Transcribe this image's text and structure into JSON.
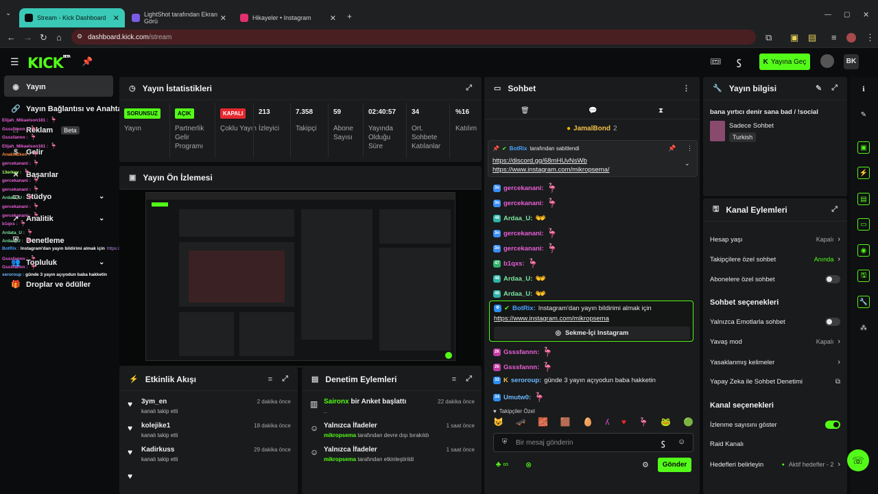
{
  "browser": {
    "tabs": [
      {
        "label": "Stream - Kick Dashboard",
        "fav": "#53fc18"
      },
      {
        "label": "LightShot tarafından Ekran Görü",
        "fav": "#7b5ce6"
      },
      {
        "label": "Hikayeler • Instagram",
        "fav": "#e1306c"
      }
    ],
    "url_host": "dashboard.kick.com",
    "url_path": "/stream"
  },
  "header": {
    "logo": "KICK",
    "logo_sup": "BETA",
    "go_live": "Yayına Geç"
  },
  "sidenav": {
    "items": [
      {
        "label": "Yayın",
        "icon": "◉"
      },
      {
        "label": "Yayın Bağlantısı ve Anahtar",
        "icon": "🔗"
      },
      {
        "label": "Reklam",
        "icon": "□",
        "badge": "Beta"
      },
      {
        "label": "Gelir",
        "icon": "$"
      },
      {
        "label": "Başarılar",
        "icon": "✕"
      },
      {
        "label": "Stüdyo",
        "icon": "▭"
      },
      {
        "label": "Analitik",
        "icon": "↗"
      },
      {
        "label": "Denetleme",
        "icon": "⛨"
      },
      {
        "label": "Topluluk",
        "icon": "👥"
      },
      {
        "label": "Droplar ve ödüller",
        "icon": "🎁"
      }
    ]
  },
  "overlay_chat": [
    {
      "user": "Elijah_Mikaelson181 :",
      "color": "#e85fd6"
    },
    {
      "user": "Gsssfannn :",
      "color": "#e85fd6"
    },
    {
      "user": "Gsssfannn :",
      "color": "#e85fd6"
    },
    {
      "user": "Elijah_Mikaelson181 :",
      "color": "#e85fd6"
    },
    {
      "user": "Anakin2ken :",
      "color": "#ff8a3d"
    },
    {
      "user": "gercekanani :",
      "color": "#e85fd6"
    },
    {
      "user": "13erkay :",
      "color": "#a5ff6b"
    },
    {
      "user": "gercekanani :",
      "color": "#e85fd6"
    },
    {
      "user": "gercekanani :",
      "color": "#e85fd6"
    },
    {
      "user": "Ardata_U :",
      "color": "#7de4a2"
    },
    {
      "user": "gercekanani :",
      "color": "#e85fd6"
    },
    {
      "user": "gercekanani :",
      "color": "#e85fd6"
    },
    {
      "user": "b1qxs :",
      "color": "#e85fd6"
    },
    {
      "user": "Ardata_U :",
      "color": "#7de4a2"
    },
    {
      "user": "Ardaa_U :",
      "color": "#7de4a2"
    },
    {
      "user": "BotRix :",
      "color": "#4aa3ff",
      "text": "Instagram'dan yayın bildirimi almak için",
      "link": "https://www.instagram.com/mikropsema"
    },
    {
      "user": "Gsssfannn :",
      "color": "#e85fd6"
    },
    {
      "user": "Gsssfannn :",
      "color": "#e85fd6"
    },
    {
      "user": "seroroup :",
      "color": "#6fb7ff",
      "text": "günde 3 yayın açıyodun baba hakketin"
    }
  ],
  "stats": {
    "title": "Yayın İstatistikleri",
    "items": [
      {
        "badge": "SORUNSUZ",
        "badge_color": "#53fc18",
        "label": "Yayın"
      },
      {
        "badge": "AÇIK",
        "badge_color": "#53fc18",
        "label": "Partnerlik Gelir Programı"
      },
      {
        "badge": "KAPALI",
        "badge_color": "#e5282e",
        "label": "Çoklu Yayın"
      },
      {
        "value": "213",
        "label": "İzleyici"
      },
      {
        "value": "7.358",
        "label": "Takipçi"
      },
      {
        "value": "59",
        "label": "Abone Sayısı"
      },
      {
        "value": "02:40:57",
        "label": "Yayında Olduğu Süre"
      },
      {
        "value": "34",
        "label": "Ort. Sohbete Katılanlar"
      },
      {
        "value": "%16",
        "label": "Katılım"
      }
    ]
  },
  "preview": {
    "title": "Yayın Ön İzlemesi"
  },
  "activity": {
    "title": "Etkinlik Akışı",
    "rows": [
      {
        "user": "3ym_en",
        "action": "kanalı takip etti",
        "time": "2 dakika önce"
      },
      {
        "user": "kolejike1",
        "action": "kanalı takip etti",
        "time": "18 dakika önce"
      },
      {
        "user": "Kadirkuss",
        "action": "kanalı takip etti",
        "time": "29 dakika önce"
      }
    ]
  },
  "moderation": {
    "title": "Denetim Eylemleri",
    "rows": [
      {
        "actor": "Saironx",
        "title": "bir Anket başlattı",
        "sub": "..",
        "time": "22 dakika önce"
      },
      {
        "title": "Yalnızca İfadeler",
        "actor": "mikropsema",
        "sub": "tarafından devre dışı bırakıldı",
        "time": "1 saat önce"
      },
      {
        "title": "Yalnızca İfadeler",
        "actor": "mikropsema",
        "sub": "tarafından etkinleştirildi",
        "time": "1 saat önce"
      }
    ]
  },
  "chat": {
    "title": "Sohbet",
    "top_user": "JamalBond",
    "top_count": "2",
    "pinned_by": "BotRix",
    "pinned_label": "tarafından sabitlendi",
    "pinned_links": [
      "https://discord.gg/68mHUvNsWb",
      "https://www.instagram.com/mikropsema/"
    ],
    "messages": [
      {
        "user": "gercekanani:",
        "color": "#e85fd6",
        "sub": "3o",
        "subc": "#3a8ef6",
        "emote": "🦩"
      },
      {
        "user": "gercekanani:",
        "color": "#e85fd6",
        "sub": "3o",
        "subc": "#3a8ef6",
        "emote": "🦩"
      },
      {
        "user": "Ardaa_U:",
        "color": "#7de4a2",
        "sub": "48",
        "subc": "#2eb3a6",
        "emote": "👐"
      },
      {
        "user": "gercekanani:",
        "color": "#e85fd6",
        "sub": "3o",
        "subc": "#3a8ef6",
        "emote": "🦩"
      },
      {
        "user": "gercekanani:",
        "color": "#e85fd6",
        "sub": "3o",
        "subc": "#3a8ef6",
        "emote": "🦩"
      },
      {
        "user": "b1qxs:",
        "color": "#e85fd6",
        "sub": "47",
        "subc": "#2eb36a",
        "emote": "🦩"
      },
      {
        "user": "Ardaa_U:",
        "color": "#7de4a2",
        "sub": "48",
        "subc": "#2eb3a6",
        "emote": "👐"
      },
      {
        "user": "Ardaa_U:",
        "color": "#7de4a2",
        "sub": "48",
        "subc": "#2eb3a6",
        "emote": "👐"
      }
    ],
    "botrix_user": "BotRix:",
    "botrix_text": "Instagram'dan yayın bildirimi almak için",
    "botrix_link": "https://www.instagram.com/mikropsema",
    "botrix_button": "Sekme-İçi Instagram",
    "messages2": [
      {
        "user": "Gsssfannn:",
        "color": "#e85fd6",
        "sub": "2k",
        "subc": "#c53ca6",
        "emote": "🦩"
      },
      {
        "user": "Gsssfannn:",
        "color": "#e85fd6",
        "sub": "2k",
        "subc": "#c53ca6",
        "emote": "🦩"
      },
      {
        "user": "seroroup:",
        "color": "#6fb7ff",
        "sub": "33",
        "subc": "#2d8df0",
        "text": "günde 3 yayın açıyodun baba hakketin"
      },
      {
        "user": "Umutw0:",
        "color": "#6fb7ff",
        "sub": "34",
        "subc": "#2d8df0",
        "emote": "🦩"
      }
    ],
    "follower_label": "Takipçiler Özel",
    "input_placeholder": "Bir mesaj gönderin",
    "send": "Gönder"
  },
  "stream_info": {
    "title": "Yayın bilgisi",
    "stream_title": "bana yırtıcı denir sana bad / !social",
    "category": "Sadece Sohbet",
    "tag": "Turkish"
  },
  "channel_actions": {
    "title": "Kanal Eylemleri",
    "rows": [
      {
        "label": "Hesap yaşı",
        "value": "Kapalı",
        "kind": "chev"
      },
      {
        "label": "Takipçilere özel sohbet",
        "value": "Anında",
        "kind": "chev",
        "green": true
      },
      {
        "label": "Abonelere özel sohbet",
        "kind": "toggle",
        "on": false
      }
    ],
    "chat_section": "Sohbet seçenekleri",
    "chat_rows": [
      {
        "label": "Yalnızca Emotlarla sohbet",
        "kind": "toggle",
        "on": false
      },
      {
        "label": "Yavaş mod",
        "value": "Kapalı",
        "kind": "chev"
      },
      {
        "label": "Yasaklanmış kelimeler",
        "value": "",
        "kind": "chev"
      },
      {
        "label": "Yapay Zeka ile Sohbet Denetimi",
        "value": "",
        "kind": "ext"
      }
    ],
    "channel_section": "Kanal seçenekleri",
    "channel_rows": [
      {
        "label": "İzlenme sayısını göster",
        "kind": "toggle",
        "on": true
      },
      {
        "label": "Raid Kanalı",
        "value": "",
        "kind": "none"
      },
      {
        "label": "Hedefleri belirleyin",
        "value": "Aktif hedefler - 2",
        "kind": "chev"
      }
    ]
  },
  "colors": {
    "accent": "#53fc18",
    "panel": "#191b1c",
    "bg": "#0b0c0d"
  }
}
